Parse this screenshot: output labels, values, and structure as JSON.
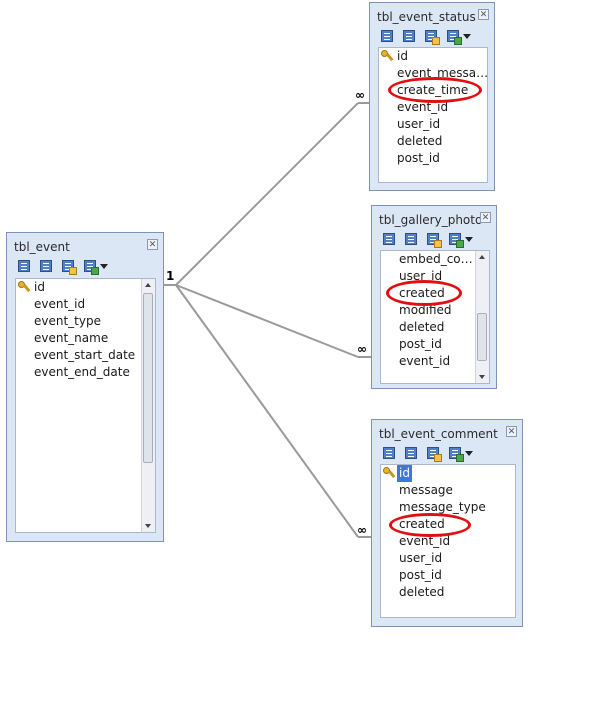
{
  "tables": {
    "event": {
      "title": "tbl_event",
      "fields": [
        "id",
        "event_id",
        "event_type",
        "event_name",
        "event_start_date",
        "event_end_date"
      ]
    },
    "status": {
      "title": "tbl_event_status",
      "fields": [
        "id",
        "event_messa…",
        "create_time",
        "event_id",
        "user_id",
        "deleted",
        "post_id"
      ]
    },
    "gallery": {
      "title": "tbl_gallery_photo",
      "fields": [
        "embed_co…",
        "user_id",
        "created",
        "modified",
        "deleted",
        "post_id",
        "event_id"
      ]
    },
    "comment": {
      "title": "tbl_event_comment",
      "fields": [
        "id",
        "message",
        "message_type",
        "created",
        "event_id",
        "user_id",
        "post_id",
        "deleted"
      ]
    }
  },
  "relations": {
    "one": "1",
    "many": "∞"
  },
  "icons": [
    "grid-add-icon",
    "grid-edit-icon",
    "grid-key-icon",
    "import-arrow-icon",
    "chevron-down-icon",
    "close-icon",
    "primary-key-icon"
  ],
  "colors": {
    "panel": "#dce7f5",
    "selection": "#3b78d8",
    "highlight": "#e01010",
    "line": "#9a9a9a"
  }
}
